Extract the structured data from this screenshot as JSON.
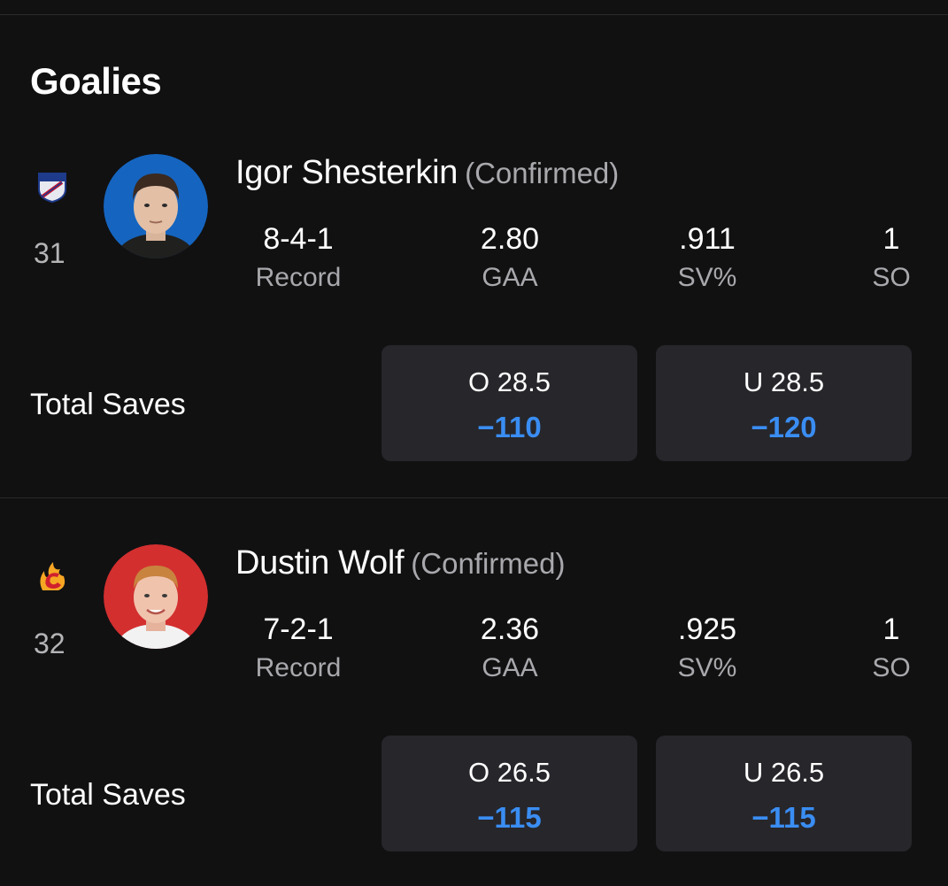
{
  "section": {
    "title": "Goalies"
  },
  "goalies": [
    {
      "name": "Igor Shesterkin",
      "status": "(Confirmed)",
      "number": "31",
      "team_icon": "rangers-logo-icon",
      "avatar_bg": "#1565c0",
      "stats": {
        "record": {
          "value": "8-4-1",
          "label": "Record"
        },
        "gaa": {
          "value": "2.80",
          "label": "GAA"
        },
        "sv": {
          "value": ".911",
          "label": "SV%"
        },
        "so": {
          "value": "1",
          "label": "SO"
        }
      },
      "prop": {
        "label": "Total Saves",
        "over": {
          "line": "O 28.5",
          "price": "−110"
        },
        "under": {
          "line": "U 28.5",
          "price": "−120"
        }
      }
    },
    {
      "name": "Dustin Wolf",
      "status": "(Confirmed)",
      "number": "32",
      "team_icon": "flames-logo-icon",
      "avatar_bg": "#d32f2f",
      "stats": {
        "record": {
          "value": "7-2-1",
          "label": "Record"
        },
        "gaa": {
          "value": "2.36",
          "label": "GAA"
        },
        "sv": {
          "value": ".925",
          "label": "SV%"
        },
        "so": {
          "value": "1",
          "label": "SO"
        }
      },
      "prop": {
        "label": "Total Saves",
        "over": {
          "line": "O 26.5",
          "price": "−115"
        },
        "under": {
          "line": "U 26.5",
          "price": "−115"
        }
      }
    }
  ],
  "colors": {
    "background": "#111112",
    "card": "#26262b",
    "price_accent": "#3a8df2",
    "muted_text": "#a9a9ad"
  }
}
